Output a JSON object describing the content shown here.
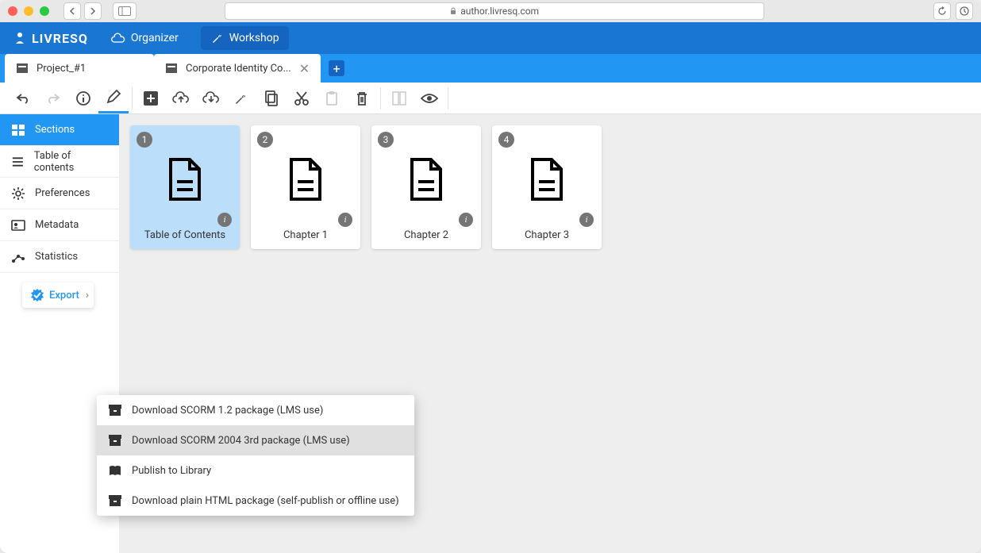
{
  "browser": {
    "url": "author.livresq.com"
  },
  "app": {
    "logo": "LIVRESQ",
    "nav": {
      "organizer": "Organizer",
      "workshop": "Workshop"
    }
  },
  "tabs": {
    "project": "Project_#1",
    "document": "Corporate Identity Co..."
  },
  "sidebar": {
    "sections": "Sections",
    "toc": "Table of contents",
    "preferences": "Preferences",
    "metadata": "Metadata",
    "statistics": "Statistics",
    "export": "Export"
  },
  "cards": [
    {
      "num": "1",
      "caption": "Table of Contents"
    },
    {
      "num": "2",
      "caption": "Chapter 1"
    },
    {
      "num": "3",
      "caption": "Chapter 2"
    },
    {
      "num": "4",
      "caption": "Chapter 3"
    }
  ],
  "export_menu": {
    "scorm12": "Download SCORM 1.2 package (LMS use)",
    "scorm2004": "Download SCORM 2004 3rd package (LMS use)",
    "library": "Publish to Library",
    "html": "Download plain HTML package (self-publish or offline use)"
  }
}
